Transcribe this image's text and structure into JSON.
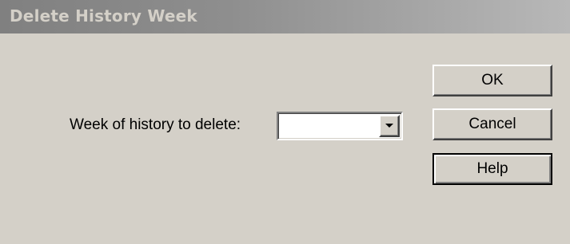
{
  "window": {
    "title": "Delete History Week"
  },
  "form": {
    "week_label": "Week of history to delete:",
    "week_value": ""
  },
  "buttons": {
    "ok_label": "OK",
    "cancel_label": "Cancel",
    "help_label": "Help"
  },
  "icons": {
    "dropdown": "chevron-down-icon"
  },
  "colors": {
    "dialog_background": "#d4d0c8",
    "titlebar_inactive": "#808080",
    "title_text": "#d4d0c8"
  }
}
